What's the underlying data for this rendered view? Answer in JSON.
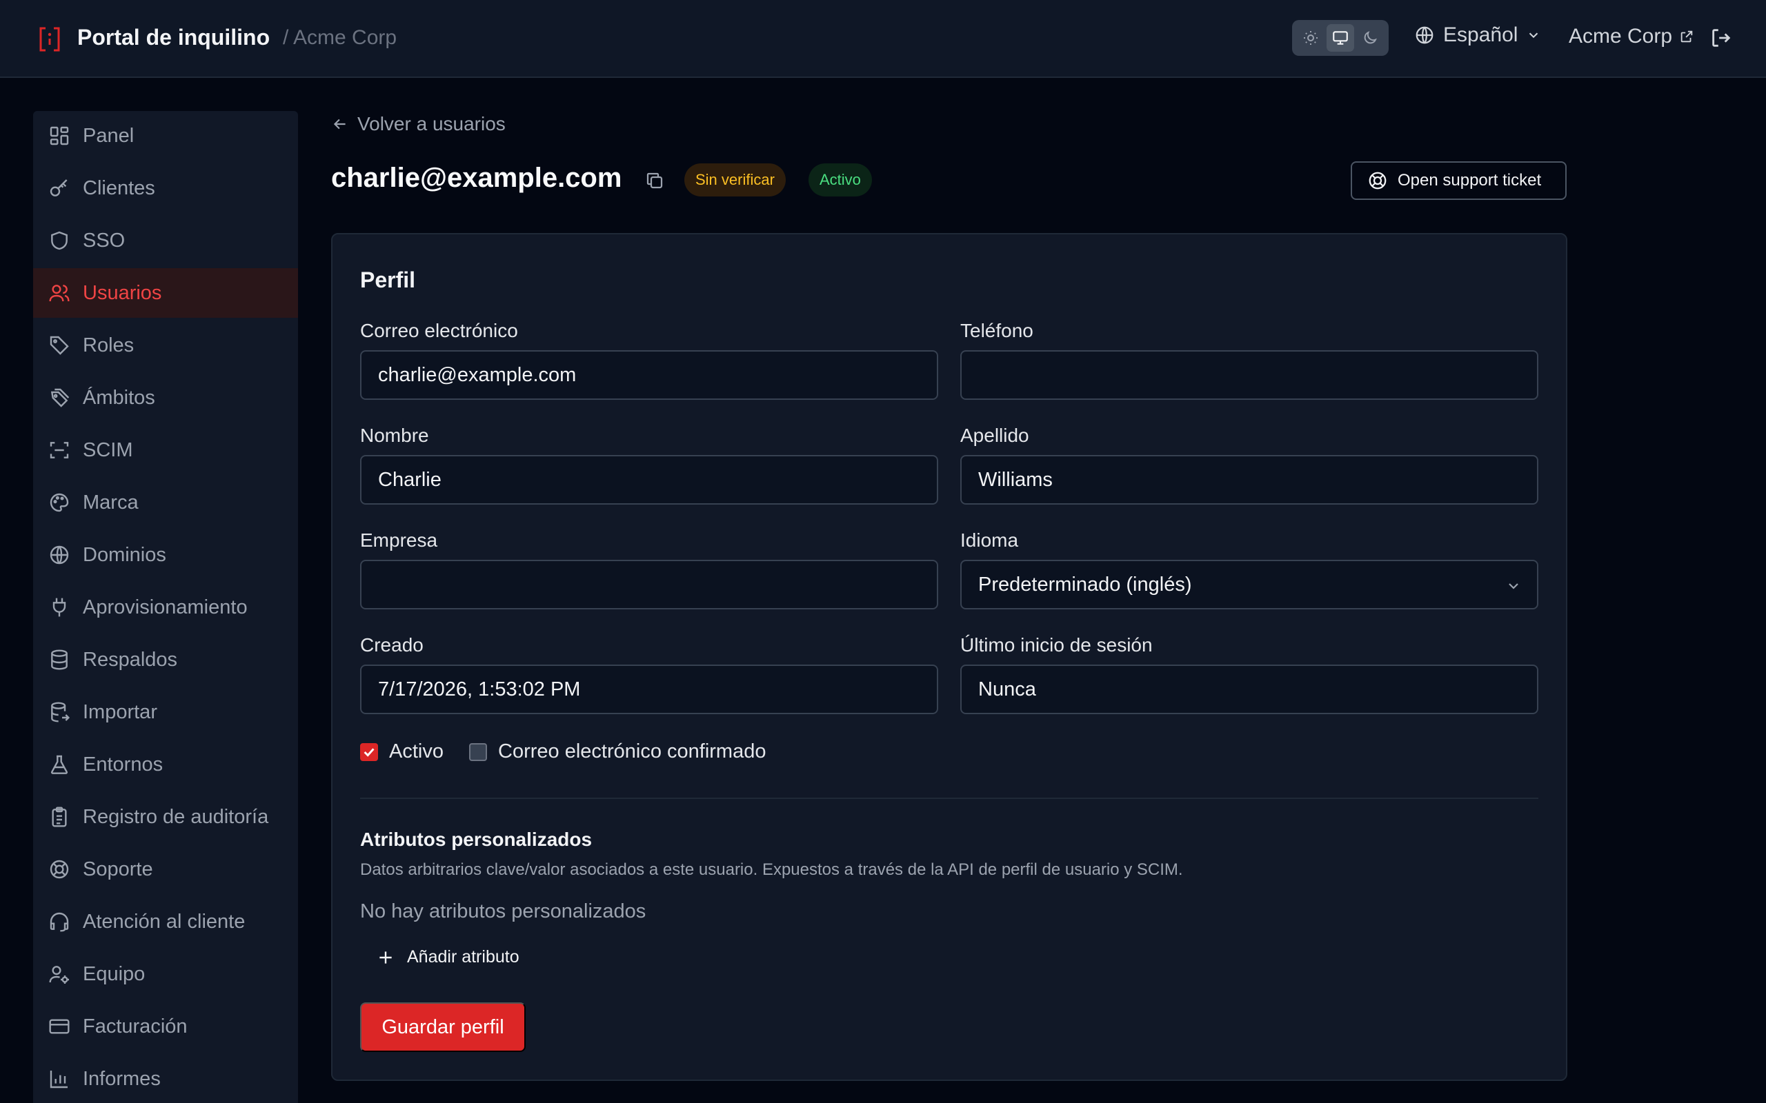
{
  "header": {
    "title": "Portal de inquilino",
    "tenant_crumb": "/ Acme Corp",
    "language": "Español",
    "tenant_link": "Acme Corp",
    "theme_modes": [
      "light",
      "system",
      "dark"
    ],
    "active_theme": "system"
  },
  "sidebar": {
    "items": [
      {
        "label": "Panel",
        "icon": "dashboard-icon"
      },
      {
        "label": "Clientes",
        "icon": "key-icon"
      },
      {
        "label": "SSO",
        "icon": "shield-icon"
      },
      {
        "label": "Usuarios",
        "icon": "users-icon",
        "active": true
      },
      {
        "label": "Roles",
        "icon": "tag-icon"
      },
      {
        "label": "Ámbitos",
        "icon": "tags-icon"
      },
      {
        "label": "SCIM",
        "icon": "scan-icon"
      },
      {
        "label": "Marca",
        "icon": "palette-icon"
      },
      {
        "label": "Dominios",
        "icon": "globe-icon"
      },
      {
        "label": "Aprovisionamiento",
        "icon": "plug-icon"
      },
      {
        "label": "Respaldos",
        "icon": "database-icon"
      },
      {
        "label": "Importar",
        "icon": "database-import-icon"
      },
      {
        "label": "Entornos",
        "icon": "flask-icon"
      },
      {
        "label": "Registro de auditoría",
        "icon": "clipboard-icon"
      },
      {
        "label": "Soporte",
        "icon": "lifebuoy-icon"
      },
      {
        "label": "Atención al cliente",
        "icon": "headset-icon"
      },
      {
        "label": "Equipo",
        "icon": "user-cog-icon"
      },
      {
        "label": "Facturación",
        "icon": "credit-card-icon"
      },
      {
        "label": "Informes",
        "icon": "bar-chart-icon"
      }
    ]
  },
  "main": {
    "back_label": "Volver a usuarios",
    "user_email": "charlie@example.com",
    "badge_unverified": "Sin verificar",
    "badge_active": "Activo",
    "support_label": "Open support ticket"
  },
  "profile": {
    "title": "Perfil",
    "email_label": "Correo electrónico",
    "email_value": "charlie@example.com",
    "phone_label": "Teléfono",
    "phone_value": "",
    "first_name_label": "Nombre",
    "first_name_value": "Charlie",
    "last_name_label": "Apellido",
    "last_name_value": "Williams",
    "company_label": "Empresa",
    "company_value": "",
    "language_label": "Idioma",
    "language_value": "Predeterminado (inglés)",
    "created_label": "Creado",
    "created_value": "7/17/2026, 1:53:02 PM",
    "last_login_label": "Último inicio de sesión",
    "last_login_value": "Nunca",
    "active_label": "Activo",
    "active_checked": true,
    "email_confirmed_label": "Correo electrónico confirmado",
    "email_confirmed_checked": false,
    "attributes_title": "Atributos personalizados",
    "attributes_description": "Datos arbitrarios clave/valor asociados a este usuario. Expuestos a través de la API de perfil de usuario y SCIM.",
    "attributes_empty": "No hay atributos personalizados",
    "add_attribute_label": "Añadir atributo",
    "save_label": "Guardar perfil"
  },
  "colors": {
    "accent": "#dc2626",
    "background": "#030712",
    "surface": "#111827",
    "warning": "#fbbf24",
    "success": "#4ade80"
  }
}
